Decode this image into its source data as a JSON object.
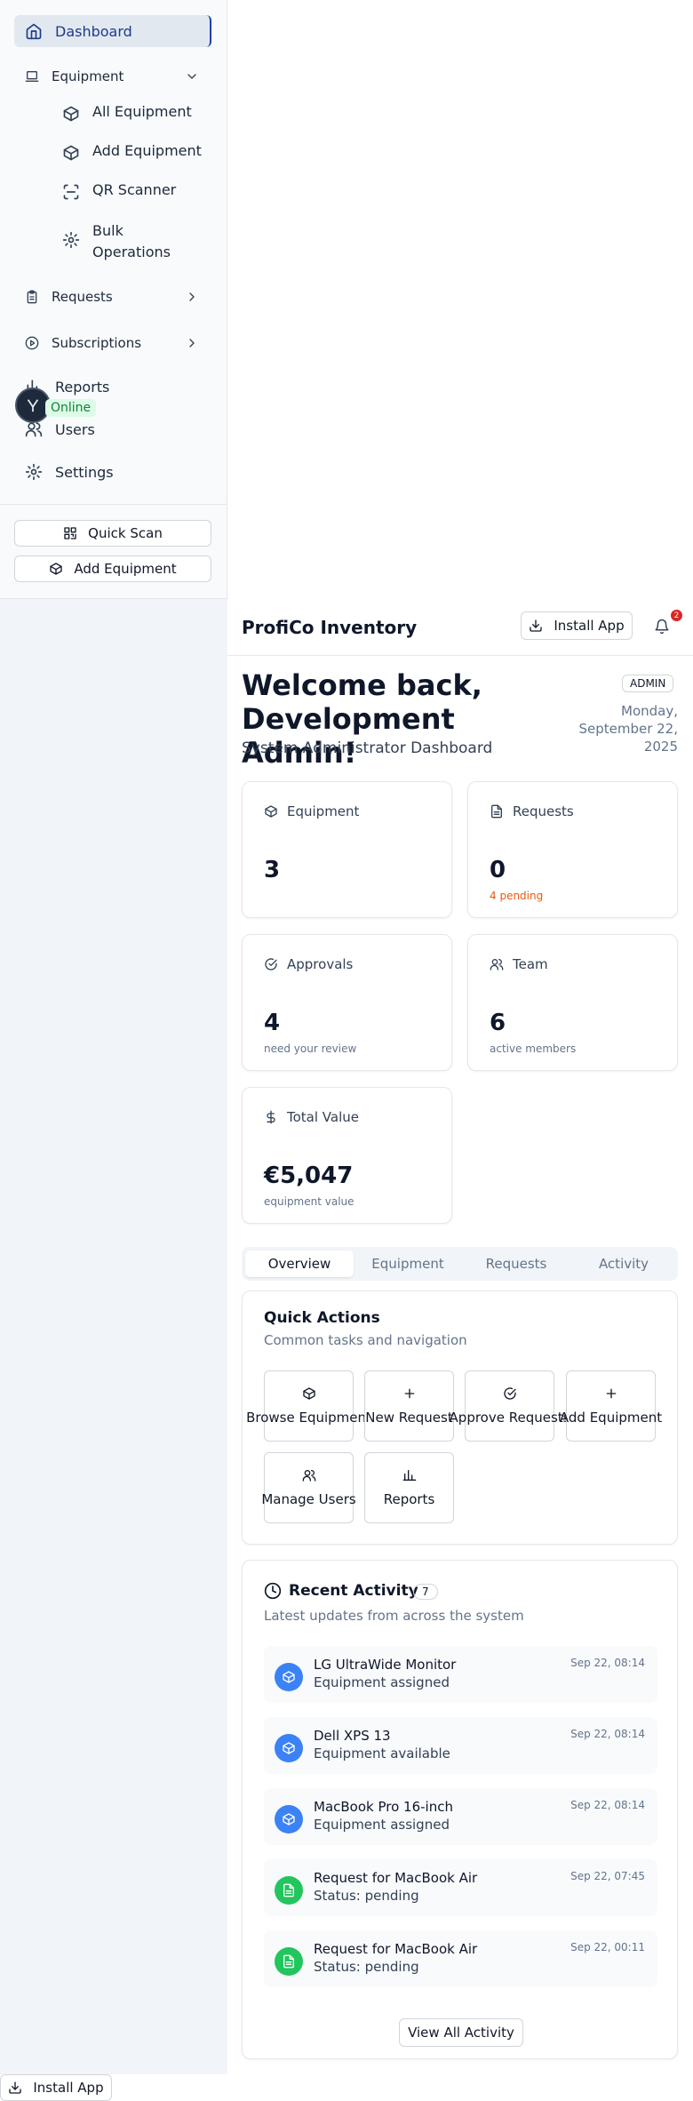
{
  "sidebar": {
    "dashboard": "Dashboard",
    "equipment": "Equipment",
    "sub": [
      "All Equipment",
      "Add Equipment",
      "QR Scanner",
      "Bulk",
      "Operations"
    ],
    "requests": "Requests",
    "subscriptions": "Subscriptions",
    "reports": "Reports",
    "users": "Users",
    "settings": "Settings",
    "online": "Online",
    "quick_scan": "Quick Scan",
    "add_equipment": "Add Equipment"
  },
  "header": {
    "title": "ProfiCo Inventory",
    "install": "Install App",
    "notif_count": "2"
  },
  "welcome": {
    "line1": "Welcome back,",
    "line2": "Development Admin!",
    "subtitle": "System Administrator Dashboard",
    "role": "ADMIN",
    "date1": "Monday,",
    "date2": "September 22,",
    "date3": "2025"
  },
  "stats": [
    {
      "label": "Equipment",
      "value": "3",
      "sub": ""
    },
    {
      "label": "Requests",
      "value": "0",
      "sub": "4 pending"
    },
    {
      "label": "Approvals",
      "value": "4",
      "sub": "need your review"
    },
    {
      "label": "Team",
      "value": "6",
      "sub": "active members"
    },
    {
      "label": "Total Value",
      "value": "€5,047",
      "sub": "equipment value"
    }
  ],
  "tabs": [
    "Overview",
    "Equipment",
    "Requests",
    "Activity"
  ],
  "quick_actions": {
    "title": "Quick Actions",
    "desc": "Common tasks and navigation",
    "items": [
      "Browse Equipment",
      "New Request",
      "Approve Requests",
      "Add Equipment",
      "Manage Users",
      "Reports"
    ]
  },
  "recent": {
    "title": "Recent Activity",
    "count": "7",
    "desc": "Latest updates from across the system",
    "items": [
      {
        "title": "LG UltraWide Monitor",
        "status": "Equipment assigned",
        "time": "Sep 22, 08:14"
      },
      {
        "title": "Dell XPS 13",
        "status": "Equipment available",
        "time": "Sep 22, 08:14"
      },
      {
        "title": "MacBook Pro 16-inch",
        "status": "Equipment assigned",
        "time": "Sep 22, 08:14"
      },
      {
        "title": "Request for MacBook Air",
        "status": "Status: pending",
        "time": "Sep 22, 07:45"
      },
      {
        "title": "Request for MacBook Air",
        "status": "Status: pending",
        "time": "Sep 22, 00:11"
      }
    ],
    "view_all": "View All Activity"
  },
  "footer": {
    "install": "Install App"
  },
  "colors": {
    "accent": "#1e40af",
    "equipment_icon": "#3b82f6",
    "request_icon": "#22c55e",
    "warning": "#ea580c",
    "notify": "#dc2626"
  }
}
